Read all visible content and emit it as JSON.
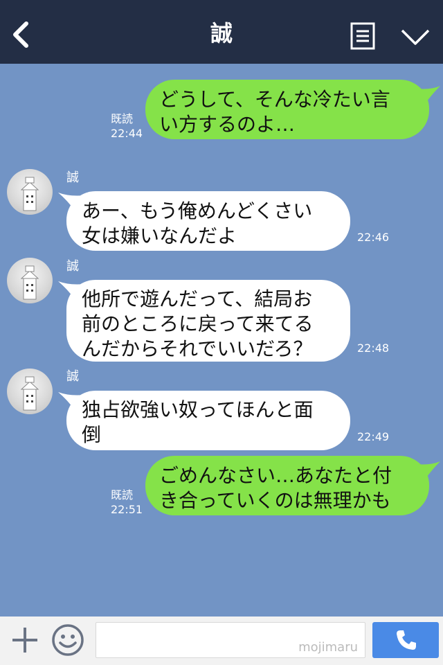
{
  "header": {
    "title": "誠"
  },
  "messages": [
    {
      "direction": "out",
      "lines": [
        "どうして、そんな冷たい言",
        "い方するのよ…"
      ],
      "read": "既読",
      "time": "22:44"
    },
    {
      "direction": "in",
      "sender": "誠",
      "lines": [
        "あー、もう俺めんどくさい",
        "女は嫌いなんだよ"
      ],
      "time": "22:46"
    },
    {
      "direction": "in",
      "sender": "誠",
      "lines": [
        "他所で遊んだって、結局お",
        "前のところに戻って来てる",
        "んだからそれでいいだろ？"
      ],
      "time": "22:48"
    },
    {
      "direction": "in",
      "sender": "誠",
      "lines": [
        "独占欲強い奴ってほんと面",
        "倒"
      ],
      "time": "22:49"
    },
    {
      "direction": "out",
      "lines": [
        "ごめんなさい…あなたと付",
        "き合っていくのは無理かも"
      ],
      "read": "既読",
      "time": "22:51"
    }
  ],
  "input": {
    "value": "",
    "watermark": "mojimaru"
  },
  "colors": {
    "header": "#232e45",
    "background": "#7294c5",
    "out_bubble": "#85e249",
    "in_bubble": "#ffffff",
    "call_button": "#4a8ae6"
  },
  "icons": [
    "back-icon",
    "menu-icon",
    "collapse-icon",
    "plus-icon",
    "smile-icon",
    "phone-icon",
    "avatar"
  ]
}
